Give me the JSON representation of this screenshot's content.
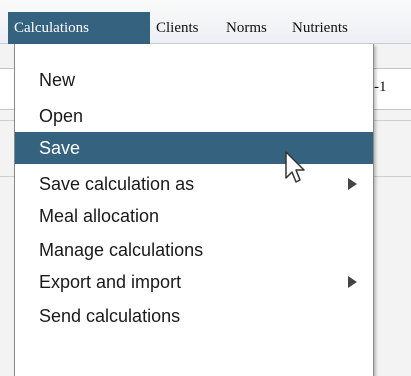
{
  "menubar": {
    "items": [
      {
        "label": "Calculations",
        "active": true
      },
      {
        "label": "Clients"
      },
      {
        "label": "Norms"
      },
      {
        "label": "Nutrients"
      }
    ]
  },
  "background": {
    "field_text": "-1"
  },
  "dropdown": {
    "items": [
      {
        "label": "New"
      },
      {
        "label": "Open"
      },
      {
        "label": "Save",
        "highlighted": true
      },
      {
        "label": "Save calculation as",
        "submenu": true
      },
      {
        "label": "Meal allocation"
      },
      {
        "label": "Manage calculations"
      },
      {
        "label": "Export and import",
        "submenu": true
      },
      {
        "label": "Send calculations"
      }
    ]
  },
  "colors": {
    "highlight": "#35627f",
    "menu_background": "#ffffff"
  },
  "icons": {
    "cursor": "mouse-pointer-icon",
    "submenu": "triangle-right-icon"
  }
}
